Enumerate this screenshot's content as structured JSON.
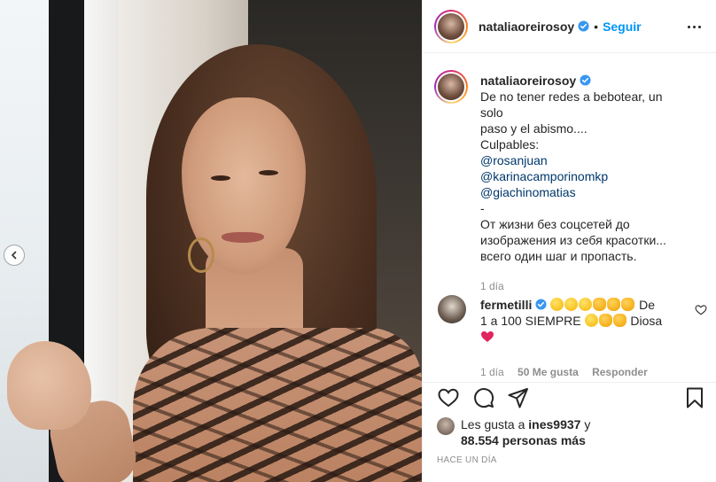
{
  "post": {
    "username": "nataliaoreirosoy",
    "separator": "•",
    "follow_label": "Seguir"
  },
  "caption": {
    "username": "nataliaoreirosoy",
    "lines": [
      "De no tener redes a bebotear, un solo",
      "paso y el abismo....",
      "Culpables:"
    ],
    "mentions": [
      "@rosanjuan",
      "@karinacamporinomkp",
      "@giachinomatias"
    ],
    "dash": "-",
    "russian_lines": [
      "От жизни без соцсетей до",
      "изображения из себя красотки...",
      "всего один шаг и пропасть."
    ],
    "time": "1 día"
  },
  "comment": {
    "username": "fermetilli",
    "text_1": "De",
    "text_2": "1 a 100 SIEMPRE",
    "text_3": "Diosa",
    "time": "1 día",
    "likes": "50 Me gusta",
    "reply_label": "Responder"
  },
  "likes": {
    "prefix": "Les gusta a",
    "user": "ines9937",
    "connector": "y",
    "count": "88.554 personas más"
  },
  "timestamp": "HACE UN DÍA",
  "icons": {
    "verified": "verified-badge-icon",
    "like": "heart-icon",
    "comment": "comment-bubble-icon",
    "share": "paper-plane-icon",
    "save": "bookmark-icon",
    "more": "more-options-icon",
    "prev": "chevron-left-icon"
  },
  "colors": {
    "accent": "#0095f6",
    "mention": "#00376b",
    "muted": "#8e8e8e",
    "heart": "#ed4956"
  }
}
